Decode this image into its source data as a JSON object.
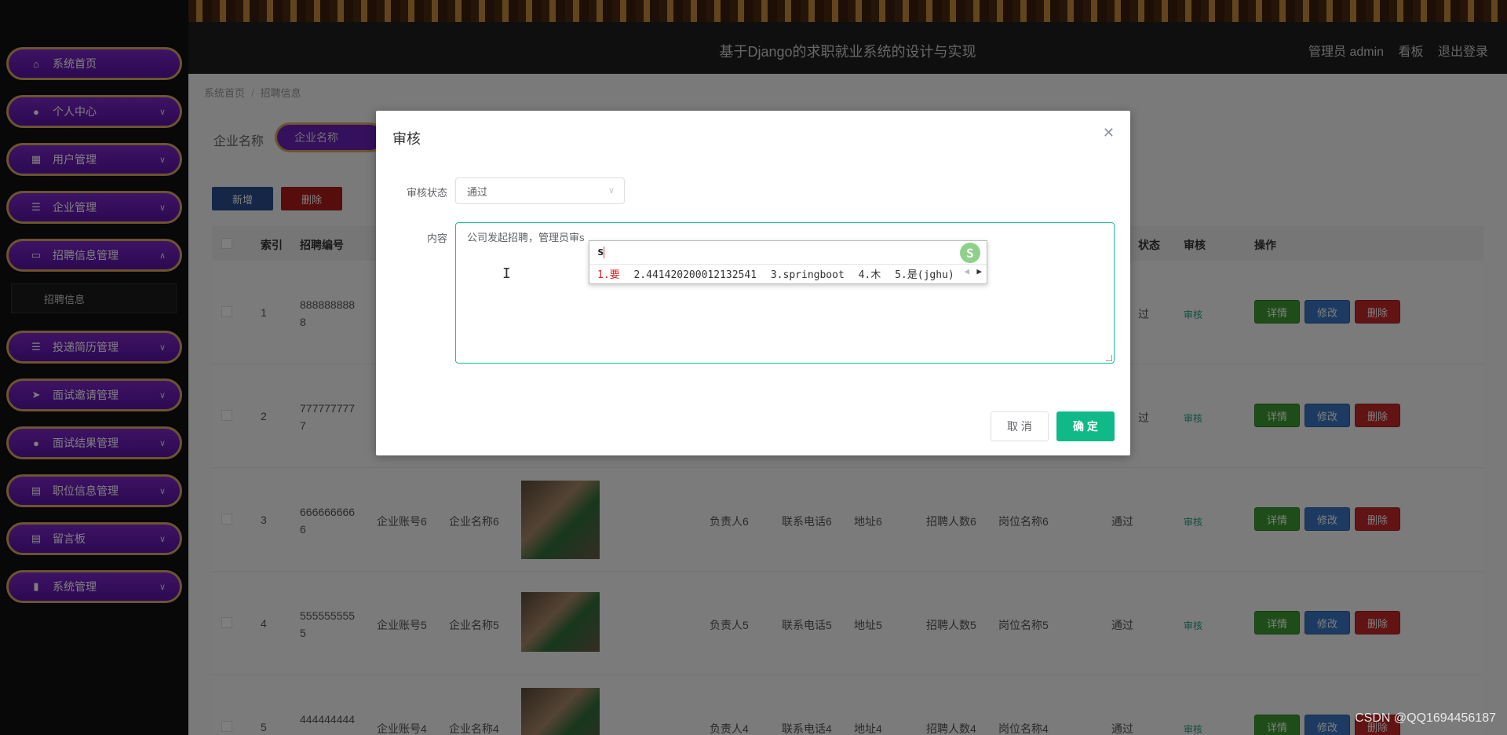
{
  "header": {
    "title": "基于Django的求职就业系统的设计与实现",
    "user_label": "管理员 admin",
    "board_label": "看板",
    "logout_label": "退出登录"
  },
  "sidebar": {
    "items": [
      {
        "label": "系统首页",
        "icon": "home-icon"
      },
      {
        "label": "个人中心",
        "icon": "user-icon"
      },
      {
        "label": "用户管理",
        "icon": "grid-icon"
      },
      {
        "label": "企业管理",
        "icon": "list-icon"
      },
      {
        "label": "招聘信息管理",
        "icon": "monitor-icon"
      },
      {
        "label": "投递简历管理",
        "icon": "list-icon"
      },
      {
        "label": "面试邀请管理",
        "icon": "send-icon"
      },
      {
        "label": "面试结果管理",
        "icon": "user-icon"
      },
      {
        "label": "职位信息管理",
        "icon": "clipboard-icon"
      },
      {
        "label": "留言板",
        "icon": "clipboard-icon"
      },
      {
        "label": "系统管理",
        "icon": "chart-icon"
      }
    ],
    "sub_item": "招聘信息"
  },
  "breadcrumb": {
    "home": "系统首页",
    "current": "招聘信息"
  },
  "search": {
    "label": "企业名称",
    "placeholder": "企业名称"
  },
  "toolbar": {
    "add_label": "新增",
    "delete_label": "删除"
  },
  "table": {
    "headers": {
      "index": "索引",
      "number": "招聘编号",
      "audit_status": "状态",
      "audit": "审核",
      "actions": "操作"
    },
    "rows": [
      {
        "index": "1",
        "number_l1": "888888888",
        "number_l2": "8",
        "account": "",
        "company": "",
        "person": "",
        "phone": "",
        "address": "",
        "count": "",
        "position": "",
        "status": "过",
        "audit": "审核"
      },
      {
        "index": "2",
        "number_l1": "777777777",
        "number_l2": "7",
        "account": "",
        "company": "",
        "person": "",
        "phone": "",
        "address": "",
        "count": "",
        "position": "",
        "status": "过",
        "audit": "审核"
      },
      {
        "index": "3",
        "number_l1": "666666666",
        "number_l2": "6",
        "account": "企业账号6",
        "company": "企业名称6",
        "person": "负责人6",
        "phone": "联系电话6",
        "address": "地址6",
        "count": "招聘人数6",
        "position": "岗位名称6",
        "status": "通过",
        "audit": "审核"
      },
      {
        "index": "4",
        "number_l1": "555555555",
        "number_l2": "5",
        "account": "企业账号5",
        "company": "企业名称5",
        "person": "负责人5",
        "phone": "联系电话5",
        "address": "地址5",
        "count": "招聘人数5",
        "position": "岗位名称5",
        "status": "通过",
        "audit": "审核"
      },
      {
        "index": "5",
        "number_l1": "444444444",
        "number_l2": "",
        "account": "企业账号4",
        "company": "企业名称4",
        "person": "负责人4",
        "phone": "联系电话4",
        "address": "地址4",
        "count": "招聘人数4",
        "position": "岗位名称4",
        "status": "通过",
        "audit": "审核"
      }
    ],
    "action_labels": {
      "detail": "详情",
      "edit": "修改",
      "remove": "删除"
    }
  },
  "dialog": {
    "title": "审核",
    "status_label": "审核状态",
    "status_value": "通过",
    "content_label": "内容",
    "content_value": "公司发起招聘，管理员审s",
    "cancel_label": "取 消",
    "ok_label": "确 定"
  },
  "ime": {
    "typed": "s",
    "logo": "S",
    "candidates": [
      "1.要",
      "2.441420200012132541",
      "3.springboot",
      "4.木",
      "5.是(jghu)"
    ]
  },
  "watermark": "CSDN @QQ1694456187",
  "colors": {
    "accent": "#10b988",
    "menu": "#6a20b8",
    "menu_border": "#d8a85a"
  }
}
